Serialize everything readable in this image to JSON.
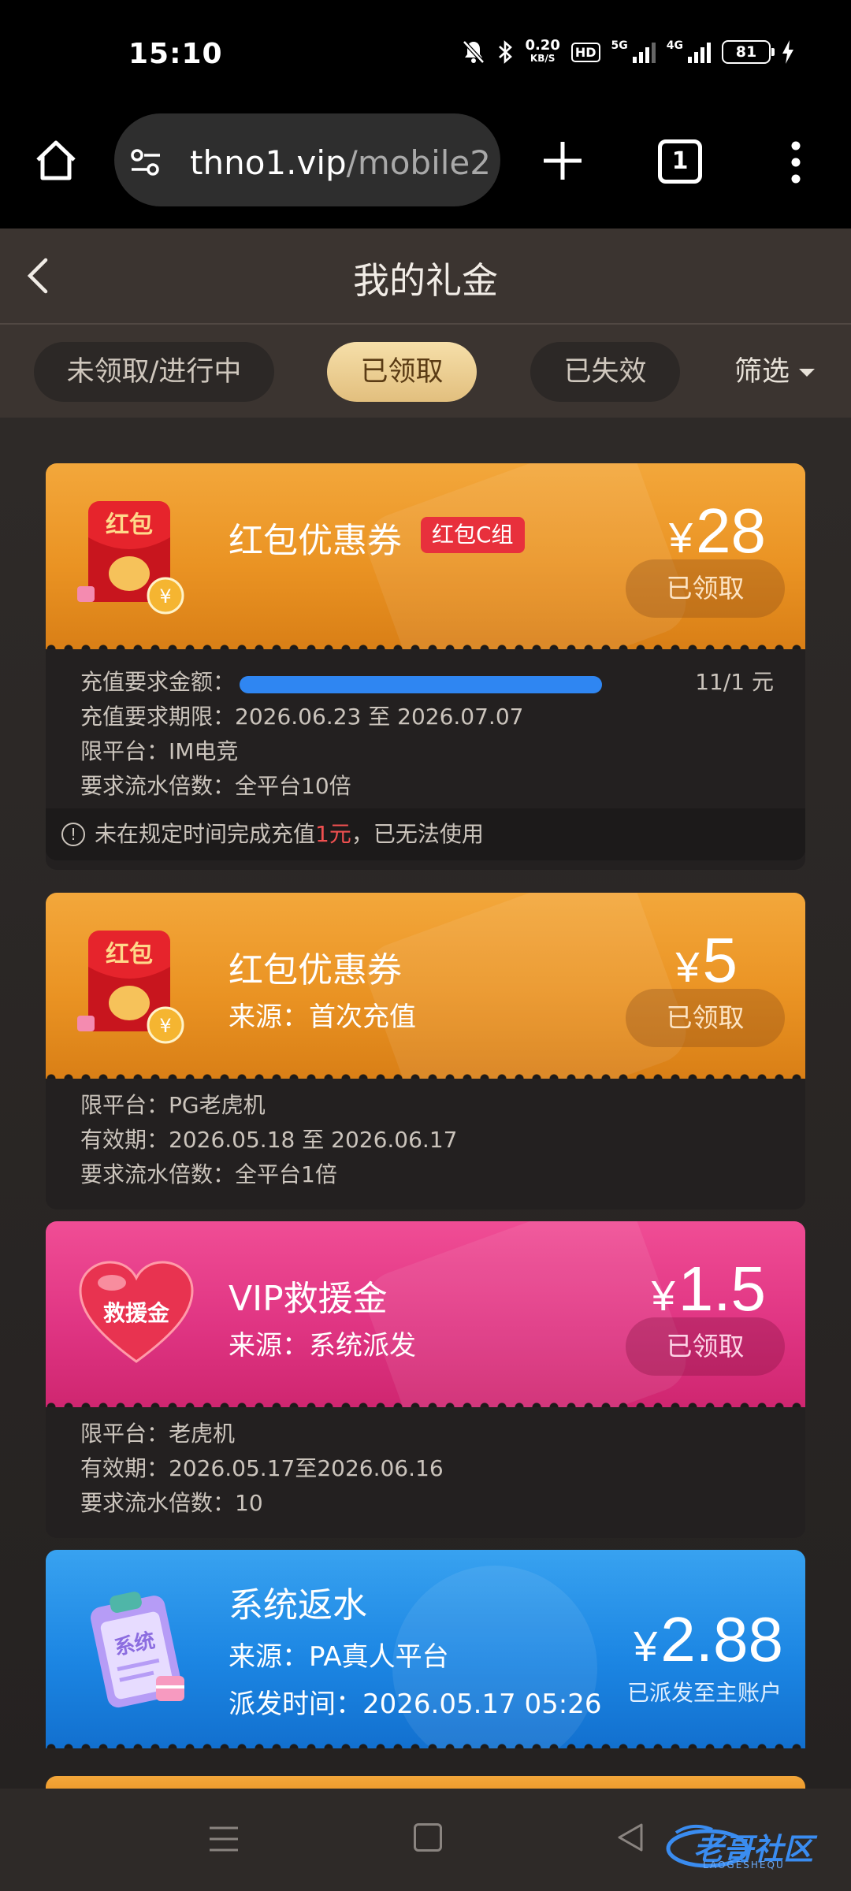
{
  "status_bar": {
    "time": "15:10",
    "net_speed_top": "0.20",
    "net_speed_unit": "KB/S",
    "hd_badge": "HD",
    "sig1_label": "5G",
    "sig2_label": "4G",
    "battery": "81"
  },
  "browser": {
    "url_domain": "thno1.vip",
    "url_path": "/mobile2",
    "tab_count": "1"
  },
  "header": {
    "title": "我的礼金"
  },
  "filters": {
    "tabs": [
      {
        "label": "未领取/进行中",
        "active": false
      },
      {
        "label": "已领取",
        "active": true
      },
      {
        "label": "已失效",
        "active": false
      }
    ],
    "filter_label": "筛选"
  },
  "cards": [
    {
      "style": "orange",
      "icon": "red-envelope-icon",
      "icon_text": "红包",
      "title": "红包优惠券",
      "tag": "红包C组",
      "currency": "¥",
      "amount": "28",
      "button": "已领取",
      "rows": [
        {
          "k": "充值要求金额：",
          "v": ""
        },
        {
          "k": "充值要求期限：",
          "v": "2026.06.23 至 2026.07.07"
        },
        {
          "k": "限平台：",
          "v": "IM电竞"
        },
        {
          "k": "要求流水倍数：",
          "v": "全平台10倍"
        }
      ],
      "progress_text": "11/1 元",
      "progress_fraction": 1.0,
      "warning_pre": "未在规定时间完成充值",
      "warning_red": "1元",
      "warning_post": "，已无法使用"
    },
    {
      "style": "orange",
      "icon": "red-envelope-icon",
      "icon_text": "红包",
      "title": "红包优惠券",
      "source": "来源：首次充值",
      "currency": "¥",
      "amount": "5",
      "button": "已领取",
      "rows": [
        {
          "k": "限平台：",
          "v": "PG老虎机"
        },
        {
          "k": "有效期：",
          "v": "2026.05.18 至 2026.06.17"
        },
        {
          "k": "要求流水倍数：",
          "v": "全平台1倍"
        }
      ]
    },
    {
      "style": "pink",
      "icon": "heart-icon",
      "icon_text": "救援金",
      "title": "VIP救援金",
      "source": "来源：系统派发",
      "currency": "¥",
      "amount": "1.5",
      "button": "已领取",
      "rows": [
        {
          "k": "限平台：",
          "v": "老虎机"
        },
        {
          "k": "有效期：",
          "v": "2026.05.17至2026.06.16"
        },
        {
          "k": "要求流水倍数：",
          "v": "10"
        }
      ]
    },
    {
      "style": "blue",
      "icon": "clipboard-icon",
      "icon_text": "系统",
      "title": "系统返水",
      "source": "来源：PA真人平台",
      "dispatch_time": "派发时间：2026.05.17 05:26",
      "currency": "¥",
      "amount": "2.88",
      "note": "已派发至主账户"
    }
  ],
  "watermark": {
    "text": "老哥社区",
    "sub": "LAOGESHEQU"
  },
  "colors": {
    "orange_card": "#ea9323",
    "pink_card": "#e03583",
    "blue_card": "#1c86e3",
    "active_tab": "#e9c98a",
    "progress": "#2f86f2",
    "warning_red": "#f05050"
  }
}
